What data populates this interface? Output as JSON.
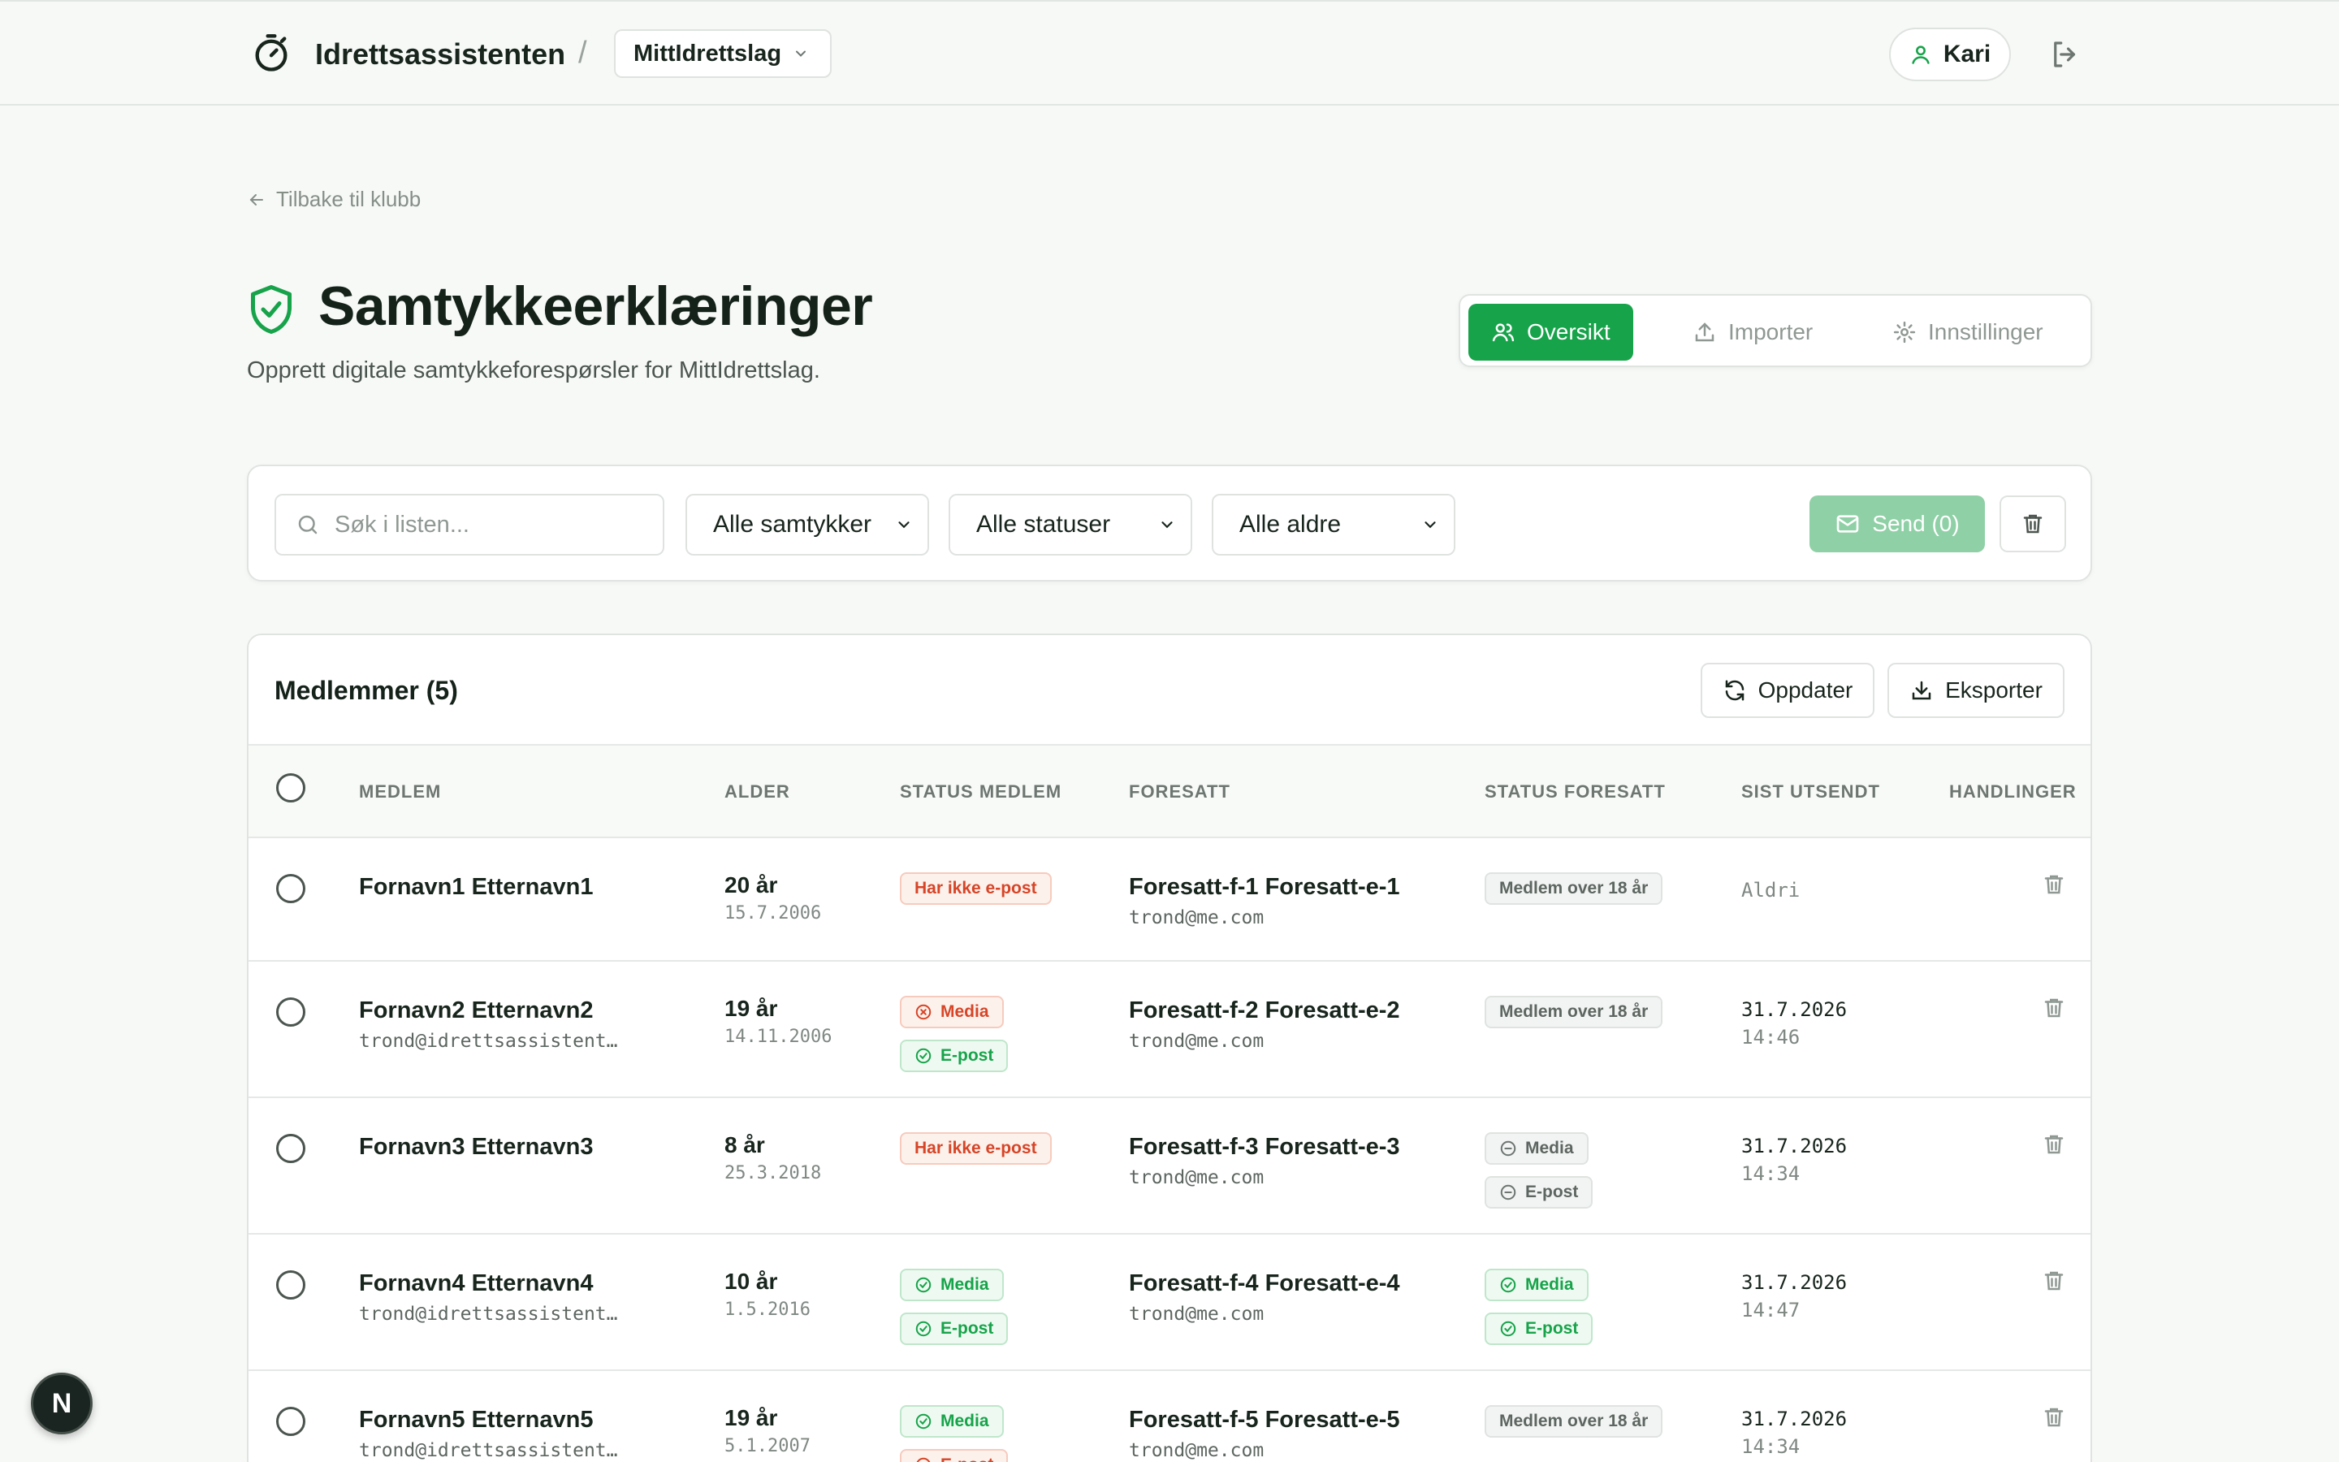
{
  "header": {
    "brand": "Idrettsassistenten",
    "separator": "/",
    "club": "MittIdrettslag",
    "user": "Kari"
  },
  "nav": {
    "back_label": "Tilbake til klubb"
  },
  "page": {
    "title": "Samtykkeerklæringer",
    "subtitle": "Opprett digitale samtykkeforespørsler for MittIdrettslag."
  },
  "tabs": [
    {
      "label": "Oversikt",
      "icon": "users-icon",
      "active": true
    },
    {
      "label": "Importer",
      "icon": "upload-icon",
      "active": false
    },
    {
      "label": "Innstillinger",
      "icon": "gear-icon",
      "active": false
    }
  ],
  "filters": {
    "search_placeholder": "Søk i listen...",
    "consent_filter": "Alle samtykker",
    "status_filter": "Alle statuser",
    "age_filter": "Alle aldre",
    "send_label": "Send (0)"
  },
  "table": {
    "title": "Medlemmer (5)",
    "refresh_label": "Oppdater",
    "export_label": "Eksporter",
    "columns": [
      "MEDLEM",
      "ALDER",
      "STATUS MEDLEM",
      "FORESATT",
      "STATUS FORESATT",
      "SIST UTSENDT",
      "HANDLINGER"
    ],
    "rows": [
      {
        "name": "Fornavn1 Etternavn1",
        "email": "",
        "age": "20 år",
        "dob": "15.7.2006",
        "member_status": [
          {
            "label": "Har ikke e-post",
            "tone": "red",
            "icon": ""
          }
        ],
        "guardian": "Foresatt-f-1 Foresatt-e-1",
        "guardian_email": "trond@me.com",
        "guardian_status": [
          {
            "label": "Medlem over 18 år",
            "tone": "gray",
            "icon": ""
          }
        ],
        "last_sent_date": "Aldri",
        "last_sent_time": ""
      },
      {
        "name": "Fornavn2 Etternavn2",
        "email": "trond@idrettsassistent…",
        "age": "19 år",
        "dob": "14.11.2006",
        "member_status": [
          {
            "label": "Media",
            "tone": "red",
            "icon": "x-circle-icon"
          },
          {
            "label": "E-post",
            "tone": "green",
            "icon": "check-circle-icon"
          }
        ],
        "guardian": "Foresatt-f-2 Foresatt-e-2",
        "guardian_email": "trond@me.com",
        "guardian_status": [
          {
            "label": "Medlem over 18 år",
            "tone": "gray",
            "icon": ""
          }
        ],
        "last_sent_date": "31.7.2026",
        "last_sent_time": "14:46"
      },
      {
        "name": "Fornavn3 Etternavn3",
        "email": "",
        "age": "8 år",
        "dob": "25.3.2018",
        "member_status": [
          {
            "label": "Har ikke e-post",
            "tone": "red",
            "icon": ""
          }
        ],
        "guardian": "Foresatt-f-3 Foresatt-e-3",
        "guardian_email": "trond@me.com",
        "guardian_status": [
          {
            "label": "Media",
            "tone": "gray",
            "icon": "minus-circle-icon"
          },
          {
            "label": "E-post",
            "tone": "gray",
            "icon": "minus-circle-icon"
          }
        ],
        "last_sent_date": "31.7.2026",
        "last_sent_time": "14:34"
      },
      {
        "name": "Fornavn4 Etternavn4",
        "email": "trond@idrettsassistent…",
        "age": "10 år",
        "dob": "1.5.2016",
        "member_status": [
          {
            "label": "Media",
            "tone": "green",
            "icon": "check-circle-icon"
          },
          {
            "label": "E-post",
            "tone": "green",
            "icon": "check-circle-icon"
          }
        ],
        "guardian": "Foresatt-f-4 Foresatt-e-4",
        "guardian_email": "trond@me.com",
        "guardian_status": [
          {
            "label": "Media",
            "tone": "green",
            "icon": "check-circle-icon"
          },
          {
            "label": "E-post",
            "tone": "green",
            "icon": "check-circle-icon"
          }
        ],
        "last_sent_date": "31.7.2026",
        "last_sent_time": "14:47"
      },
      {
        "name": "Fornavn5 Etternavn5",
        "email": "trond@idrettsassistent…",
        "age": "19 år",
        "dob": "5.1.2007",
        "member_status": [
          {
            "label": "Media",
            "tone": "green",
            "icon": "check-circle-icon"
          },
          {
            "label": "E-post",
            "tone": "red",
            "icon": "x-circle-icon"
          }
        ],
        "guardian": "Foresatt-f-5 Foresatt-e-5",
        "guardian_email": "trond@me.com",
        "guardian_status": [
          {
            "label": "Medlem over 18 år",
            "tone": "gray",
            "icon": ""
          }
        ],
        "last_sent_date": "31.7.2026",
        "last_sent_time": "14:34"
      }
    ]
  },
  "dev_badge": "N",
  "colors": {
    "accent": "#17a34a",
    "danger": "#d64527",
    "muted": "#7f8883"
  }
}
